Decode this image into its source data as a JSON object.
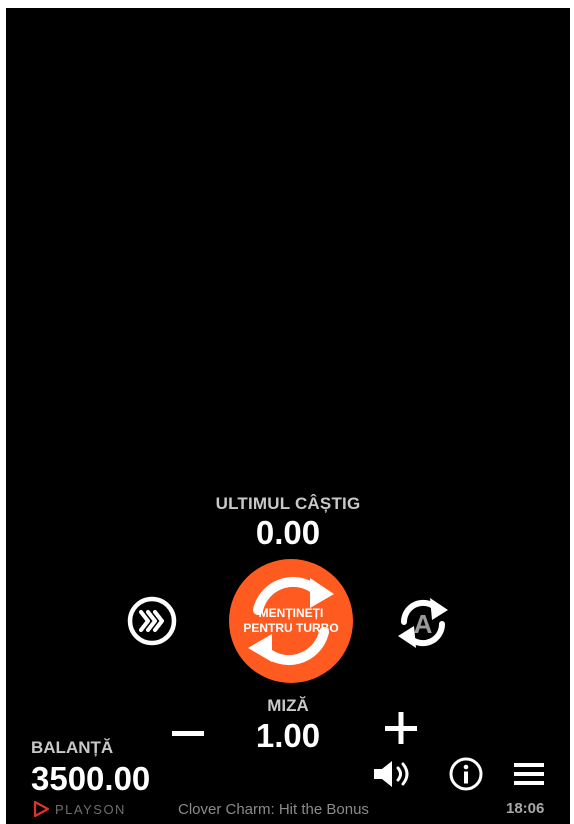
{
  "game": {
    "title": "Clover Charm: Hit the Bonus",
    "provider": "PLAYSON"
  },
  "last_win": {
    "label": "ULTIMUL CÂȘTIG",
    "value": "0.00"
  },
  "controls": {
    "spin_line1": "MENȚINEȚI",
    "spin_line2": "PENTRU TURBO",
    "turbo_icon": "fast-forward-icon",
    "autoplay_icon": "autoplay-icon",
    "autoplay_letter": "A",
    "spin_color": "#ff5a1f"
  },
  "bet": {
    "label": "MIZĂ",
    "value": "1.00"
  },
  "balance": {
    "label": "BALANȚĂ",
    "value": "3500.00"
  },
  "footer": {
    "clock": "18:06",
    "sound_icon": "speaker-icon",
    "info_icon": "info-icon",
    "menu_icon": "hamburger-menu-icon",
    "brand_color": "#e0322a"
  }
}
